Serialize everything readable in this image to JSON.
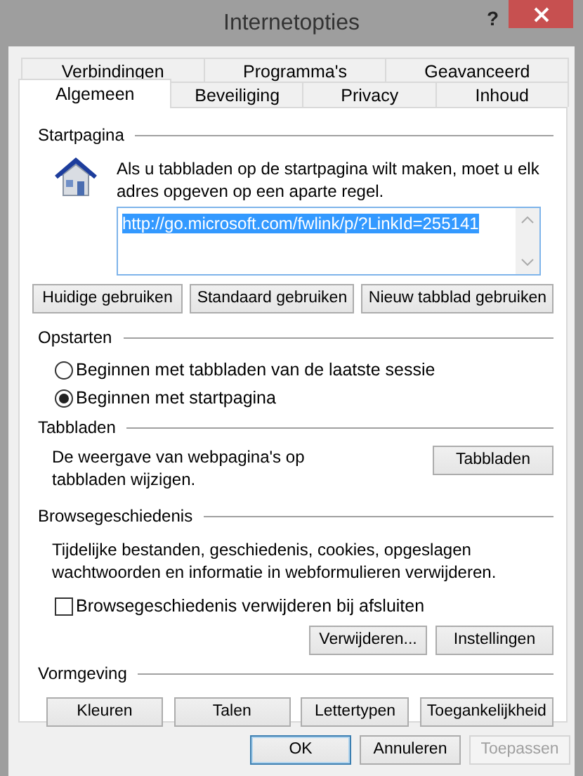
{
  "window": {
    "title": "Internetopties",
    "help": "?"
  },
  "tab_rows": [
    {
      "tabs": [
        {
          "label": "Verbindingen",
          "selected": false
        },
        {
          "label": "Programma's",
          "selected": false
        },
        {
          "label": "Geavanceerd",
          "selected": false
        }
      ]
    },
    {
      "tabs": [
        {
          "label": "Algemeen",
          "selected": true
        },
        {
          "label": "Beveiliging",
          "selected": false
        },
        {
          "label": "Privacy",
          "selected": false
        },
        {
          "label": "Inhoud",
          "selected": false
        }
      ]
    }
  ],
  "startpagina": {
    "heading": "Startpagina",
    "description": "Als u tabbladen op de startpagina wilt maken, moet u elk adres opgeven op een aparte regel.",
    "url": {
      "value": "http://go.microsoft.com/fwlink/p/?LinkId=255141",
      "selected": true
    },
    "buttons": [
      "Huidige gebruiken",
      "Standaard gebruiken",
      "Nieuw tabblad gebruiken"
    ]
  },
  "opstarten": {
    "heading": "Opstarten",
    "options": [
      {
        "label": "Beginnen met tabbladen van de laatste sessie",
        "selected": false
      },
      {
        "label": "Beginnen met startpagina",
        "selected": true
      }
    ]
  },
  "tabbladen": {
    "heading": "Tabbladen",
    "description": "De weergave van webpagina's op tabbladen wijzigen.",
    "button": "Tabbladen"
  },
  "browsegeschiedenis": {
    "heading": "Browsegeschiedenis",
    "description": "Tijdelijke bestanden, geschiedenis, cookies, opgeslagen wachtwoorden en informatie in webformulieren verwijderen.",
    "checkbox": {
      "label": "Browsegeschiedenis verwijderen bij afsluiten",
      "checked": false
    },
    "buttons": [
      "Verwijderen...",
      "Instellingen"
    ]
  },
  "vormgeving": {
    "heading": "Vormgeving",
    "buttons": [
      "Kleuren",
      "Talen",
      "Lettertypen",
      "Toegankelijkheid"
    ]
  },
  "footer_buttons": [
    {
      "label": "OK",
      "default": true,
      "disabled": false
    },
    {
      "label": "Annuleren",
      "default": false,
      "disabled": false
    },
    {
      "label": "Toepassen",
      "default": false,
      "disabled": true
    }
  ]
}
